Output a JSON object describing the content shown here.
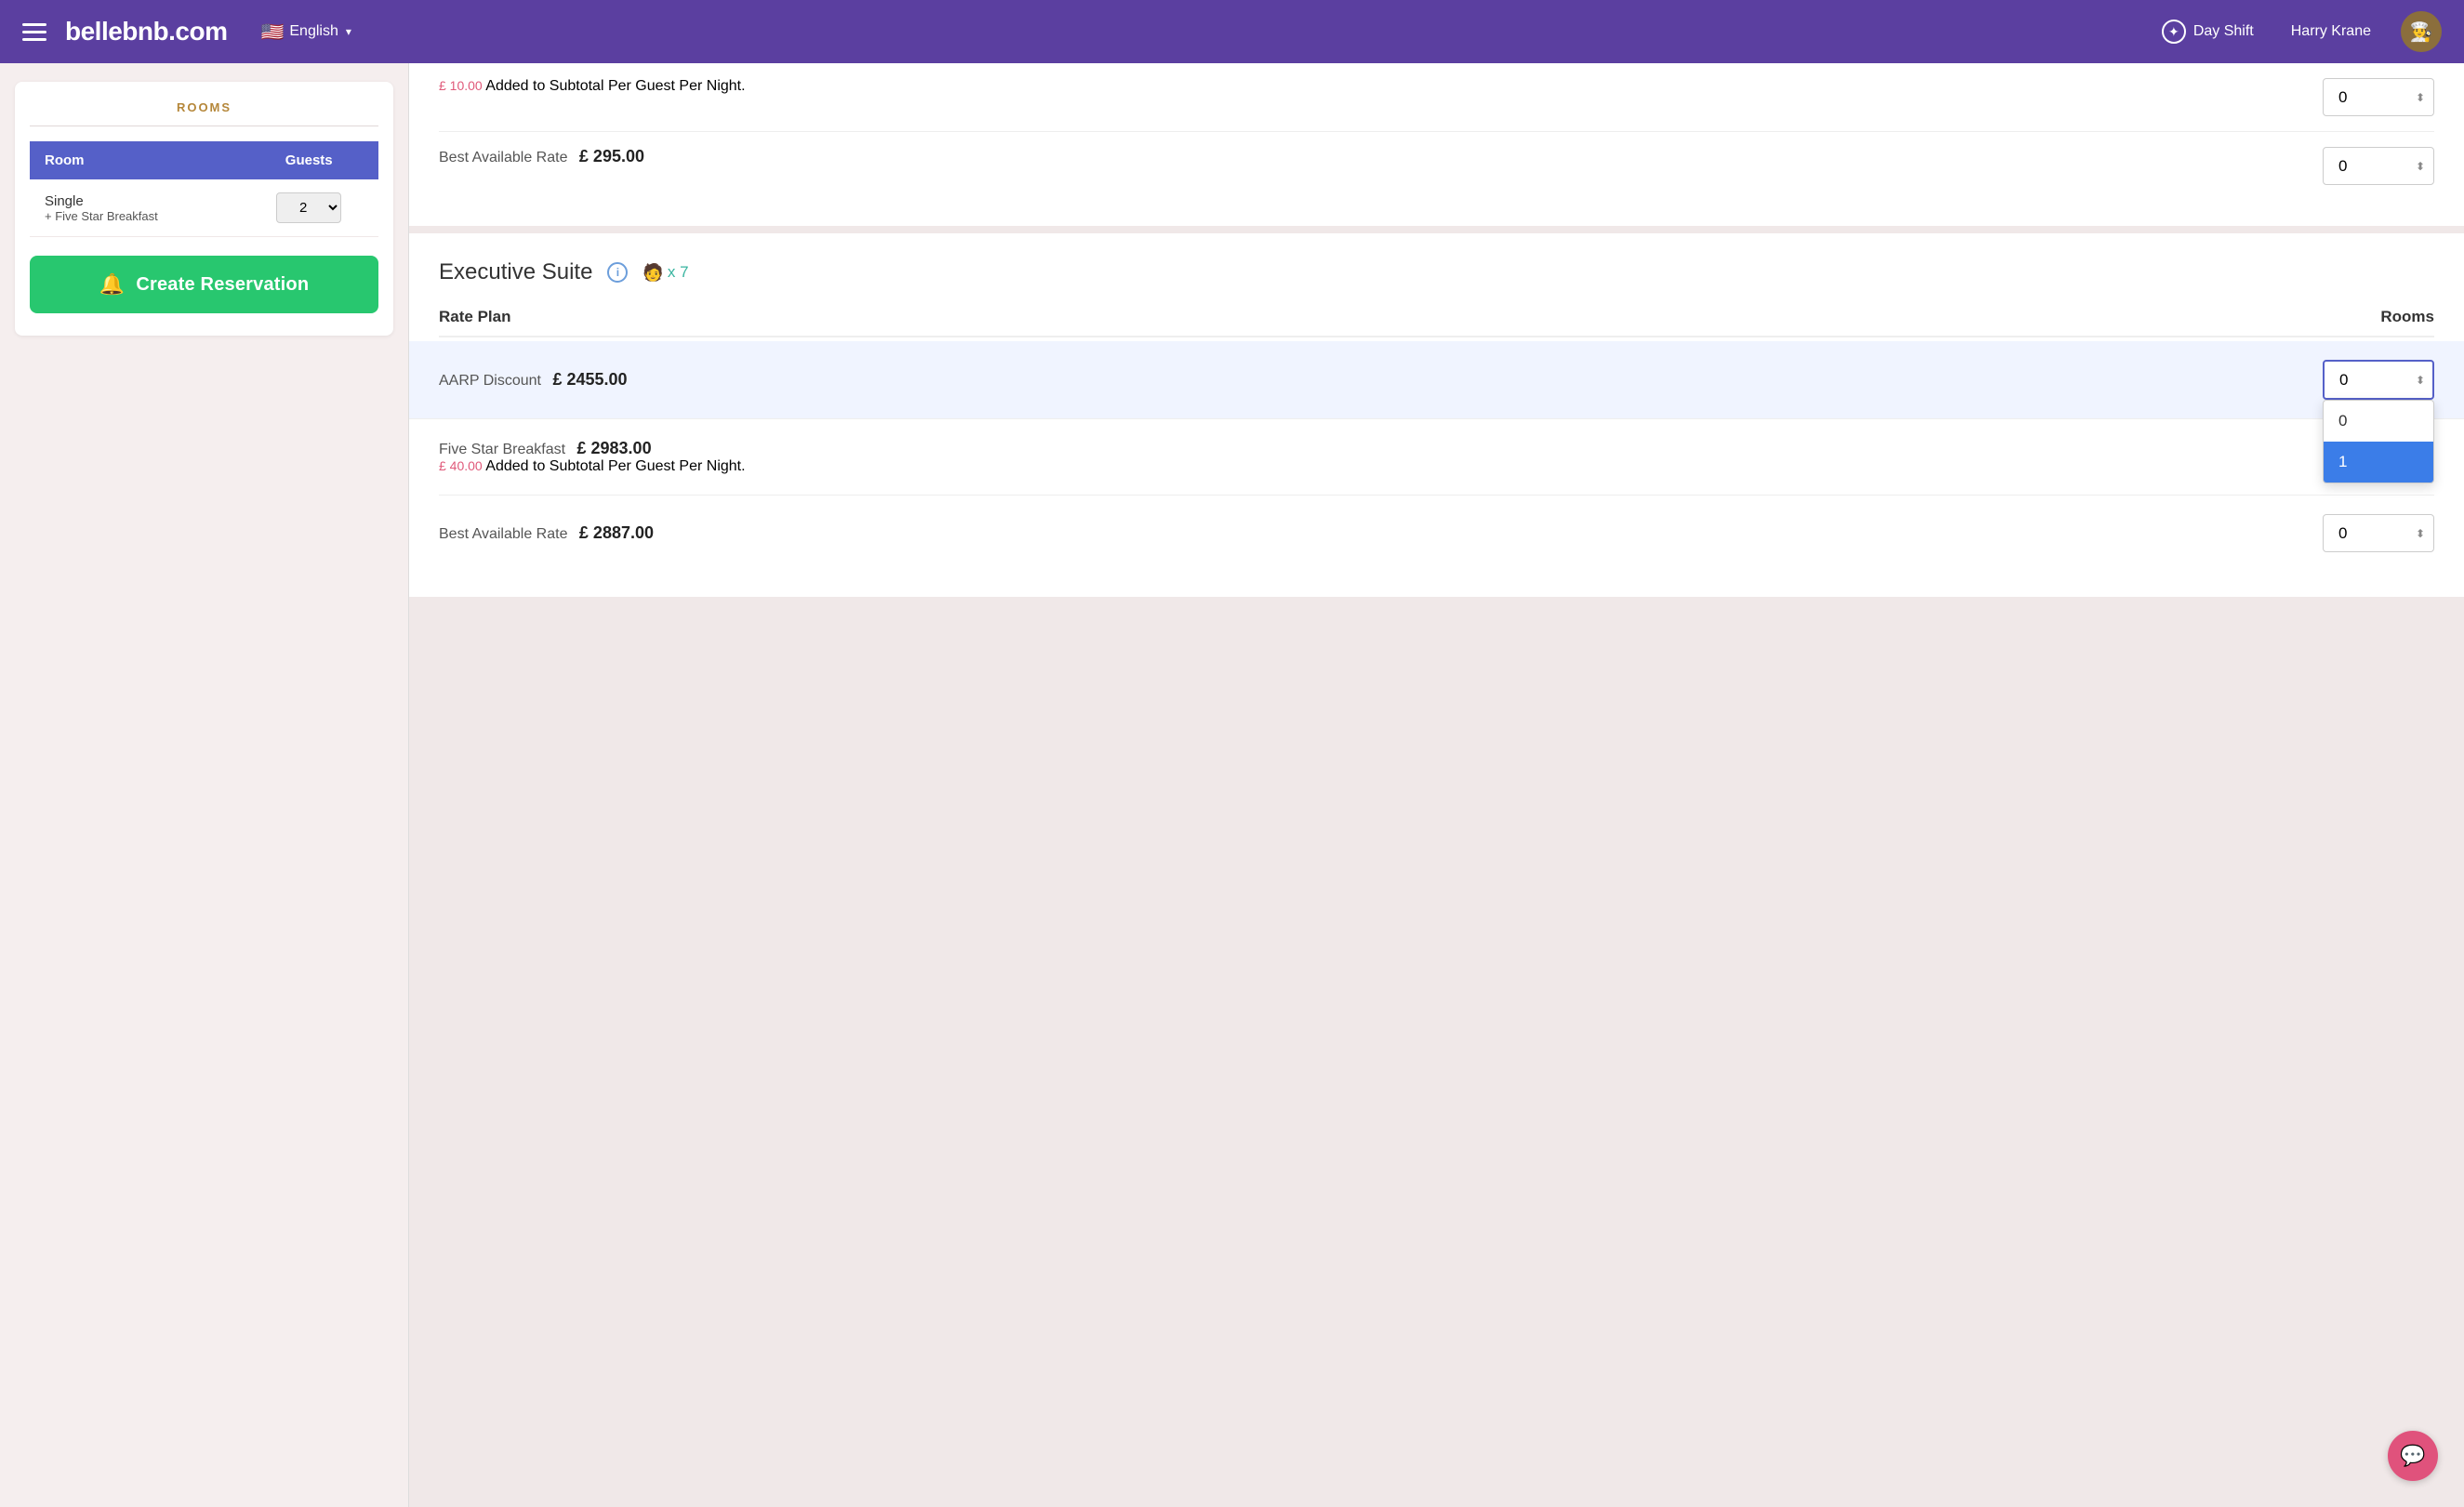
{
  "header": {
    "brand": "bellebnb.com",
    "language": "English",
    "shift": "Day Shift",
    "user": "Harry Krane",
    "menu_icon": "≡"
  },
  "sidebar": {
    "section_title": "ROOMS",
    "table": {
      "columns": [
        "Room",
        "Guests"
      ],
      "rows": [
        {
          "room_name": "Single",
          "room_sub": "+ Five Star Breakfast",
          "guests": "2"
        }
      ]
    },
    "create_reservation_label": "Create Reservation"
  },
  "content": {
    "top_section": {
      "partial_visible": true,
      "addon_text": "£ 10.00 Added to Subtotal Per Guest Per Night.",
      "best_available": {
        "label": "Best Available Rate",
        "price": "£ 295.00",
        "select_value": "0"
      }
    },
    "executive_suite": {
      "title": "Executive Suite",
      "capacity": "x 7",
      "rate_plan_header": "Rate Plan",
      "rooms_header": "Rooms",
      "rates": [
        {
          "name": "AARP Discount",
          "price": "£ 2455.00",
          "addon": "",
          "select_value": "0",
          "highlighted": true,
          "dropdown_open": true,
          "dropdown_options": [
            {
              "value": "0",
              "label": "0",
              "selected": false
            },
            {
              "value": "1",
              "label": "1",
              "selected": true
            }
          ]
        },
        {
          "name": "Five Star Breakfast",
          "price": "£ 2983.00",
          "addon": "£ 40.00 Added to Subtotal Per Guest Per Night.",
          "select_value": "0",
          "highlighted": false,
          "dropdown_open": false
        },
        {
          "name": "Best Available Rate",
          "price": "£ 2887.00",
          "addon": "",
          "select_value": "0",
          "highlighted": false,
          "dropdown_open": false
        }
      ]
    }
  },
  "chat_button": {
    "icon": "💬"
  }
}
